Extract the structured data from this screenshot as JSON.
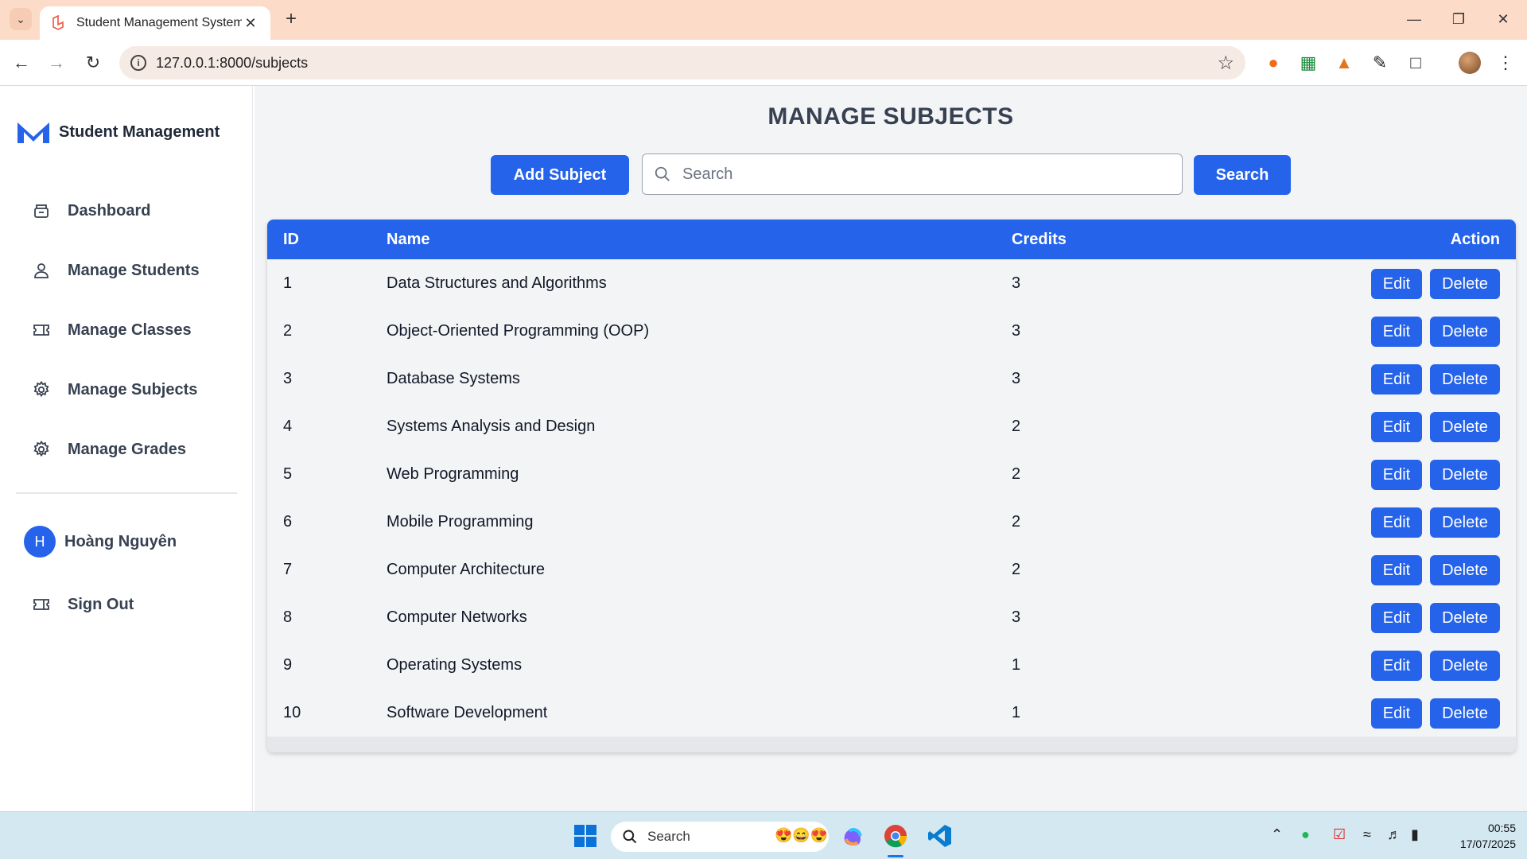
{
  "browser": {
    "tab_title": "Student Management System",
    "url": "127.0.0.1:8000/subjects"
  },
  "sidebar": {
    "brand": "Student Management",
    "items": [
      {
        "label": "Dashboard",
        "icon": "archive-box-icon"
      },
      {
        "label": "Manage Students",
        "icon": "user-icon"
      },
      {
        "label": "Manage Classes",
        "icon": "ticket-icon"
      },
      {
        "label": "Manage Subjects",
        "icon": "gear-icon"
      },
      {
        "label": "Manage Grades",
        "icon": "gear-icon"
      }
    ],
    "user": {
      "initial": "H",
      "name": "Hoàng Nguyên"
    },
    "sign_out": "Sign Out"
  },
  "main": {
    "title": "MANAGE SUBJECTS",
    "add_button": "Add Subject",
    "search_placeholder": "Search",
    "search_button": "Search",
    "columns": [
      "ID",
      "Name",
      "Credits",
      "Action"
    ],
    "edit_label": "Edit",
    "delete_label": "Delete",
    "rows": [
      {
        "id": "1",
        "name": "Data Structures and Algorithms",
        "credits": "3"
      },
      {
        "id": "2",
        "name": "Object-Oriented Programming (OOP)",
        "credits": "3"
      },
      {
        "id": "3",
        "name": "Database Systems",
        "credits": "3"
      },
      {
        "id": "4",
        "name": "Systems Analysis and Design",
        "credits": "2"
      },
      {
        "id": "5",
        "name": "Web Programming",
        "credits": "2"
      },
      {
        "id": "6",
        "name": "Mobile Programming",
        "credits": "2"
      },
      {
        "id": "7",
        "name": "Computer Architecture",
        "credits": "2"
      },
      {
        "id": "8",
        "name": "Computer Networks",
        "credits": "3"
      },
      {
        "id": "9",
        "name": "Operating Systems",
        "credits": "1"
      },
      {
        "id": "10",
        "name": "Software Development",
        "credits": "1"
      }
    ]
  },
  "taskbar": {
    "search_label": "Search",
    "time": "00:55",
    "date": "17/07/2025"
  },
  "colors": {
    "accent": "#2563eb",
    "main_bg": "#f3f4f6",
    "tabbar_bg": "#fcdcc8",
    "taskbar_bg": "#d4e8f1"
  }
}
